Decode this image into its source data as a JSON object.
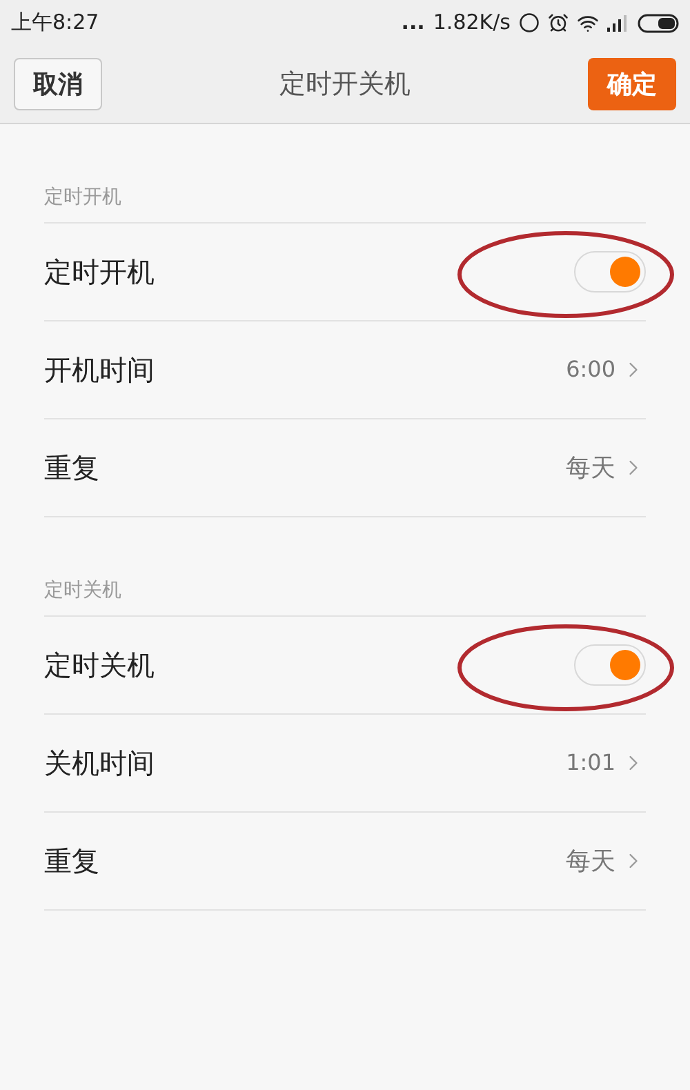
{
  "status_bar": {
    "time": "上午8:27",
    "dots": "...",
    "speed": "1.82K/s"
  },
  "header": {
    "cancel": "取消",
    "title": "定时开关机",
    "confirm": "确定"
  },
  "sections": [
    {
      "title": "定时开机",
      "rows": [
        {
          "kind": "toggle",
          "label": "定时开机",
          "on": true,
          "circled": true
        },
        {
          "kind": "nav",
          "label": "开机时间",
          "value": "6:00"
        },
        {
          "kind": "nav",
          "label": "重复",
          "value": "每天"
        }
      ]
    },
    {
      "title": "定时关机",
      "rows": [
        {
          "kind": "toggle",
          "label": "定时关机",
          "on": true,
          "circled": true
        },
        {
          "kind": "nav",
          "label": "关机时间",
          "value": "1:01"
        },
        {
          "kind": "nav",
          "label": "重复",
          "value": "每天"
        }
      ]
    }
  ]
}
